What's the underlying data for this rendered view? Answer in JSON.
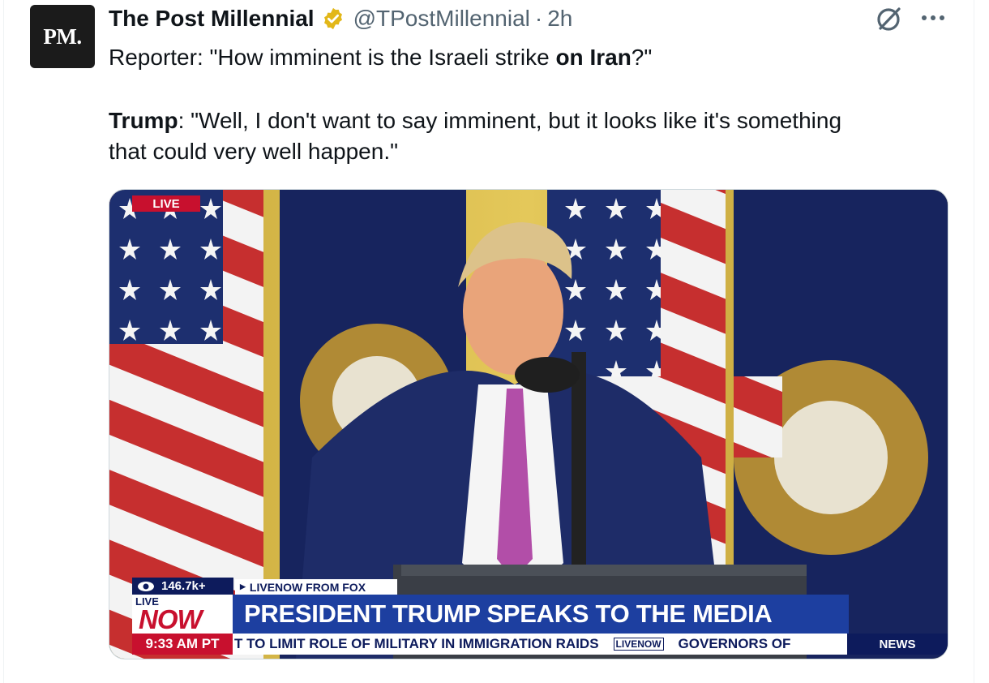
{
  "tweet": {
    "avatar_text": "PM.",
    "author_name": "The Post Millennial",
    "handle": "@TPostMillennial",
    "separator": "·",
    "time": "2h",
    "verified_color": "#e2b719",
    "line1_prefix": "Reporter: \"How imminent is the Israeli strike ",
    "line1_bold": "on Iran",
    "line1_suffix": "?\"",
    "line2_bold": "Trump",
    "line2_rest": ": \"Well, I don't want to say imminent, but it looks like it's something",
    "line3": "that could very well happen.\""
  },
  "video": {
    "live_badge": "LIVE",
    "views": "146.7k+",
    "source": "LIVENOW FROM FOX",
    "livenow_small": "LIVE",
    "livenow_big": "NOW",
    "headline": "PRESIDENT TRUMP SPEAKS TO THE MEDIA",
    "clock": "9:33 AM PT",
    "ticker_text": "T TO LIMIT ROLE OF MILITARY IN IMMIGRATION RAIDS",
    "ticker_logo": "LIVENOW",
    "ticker_text2": "GOVERNORS OF",
    "news_label": "NEWS"
  }
}
